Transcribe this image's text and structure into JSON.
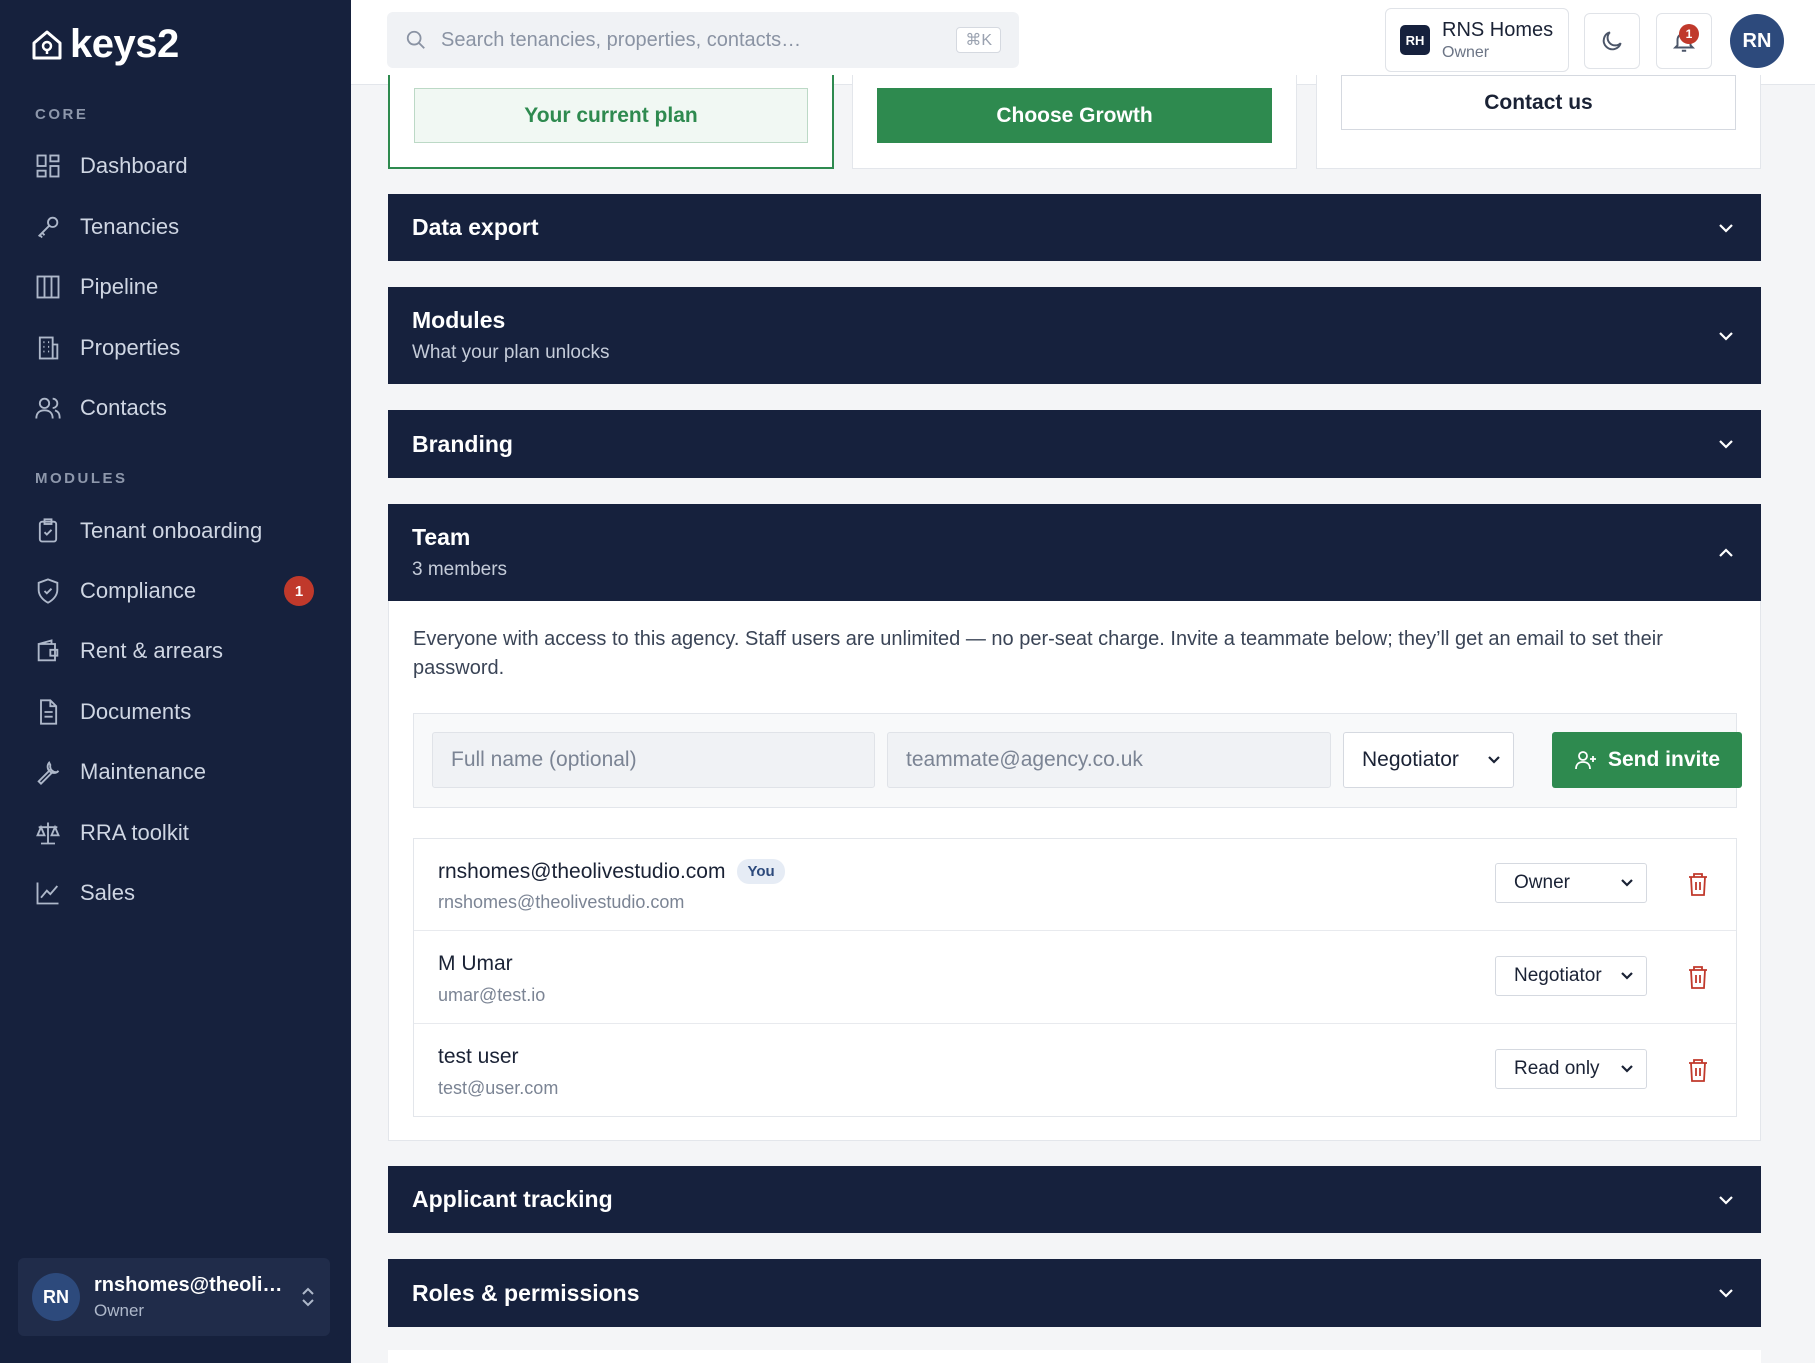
{
  "brand": {
    "name": "keys2"
  },
  "sidebar": {
    "core_label": "CORE",
    "modules_label": "MODULES",
    "core_items": [
      {
        "label": "Dashboard",
        "icon": "dashboard-icon"
      },
      {
        "label": "Tenancies",
        "icon": "key-icon"
      },
      {
        "label": "Pipeline",
        "icon": "columns-icon"
      },
      {
        "label": "Properties",
        "icon": "building-icon"
      },
      {
        "label": "Contacts",
        "icon": "users-icon"
      }
    ],
    "module_items": [
      {
        "label": "Tenant onboarding",
        "icon": "clipboard-icon"
      },
      {
        "label": "Compliance",
        "icon": "shield-icon",
        "badge": "1"
      },
      {
        "label": "Rent & arrears",
        "icon": "wallet-icon"
      },
      {
        "label": "Documents",
        "icon": "document-icon"
      },
      {
        "label": "Maintenance",
        "icon": "wrench-icon"
      },
      {
        "label": "RRA toolkit",
        "icon": "scales-icon"
      },
      {
        "label": "Sales",
        "icon": "chart-icon"
      }
    ],
    "user": {
      "initials": "RN",
      "name": "rnshomes@theolivestudio.com",
      "role": "Owner"
    }
  },
  "topbar": {
    "search_placeholder": "Search tenancies, properties, contacts…",
    "shortcut": "⌘K",
    "org": {
      "badge": "RH",
      "name": "RNS Homes",
      "role": "Owner"
    },
    "notification_count": "1",
    "avatar_initials": "RN"
  },
  "plans": {
    "current_label": "Your current plan",
    "growth_label": "Choose Growth",
    "contact_label": "Contact us"
  },
  "sections": {
    "data_export": "Data export",
    "modules": {
      "title": "Modules",
      "subtitle": "What your plan unlocks"
    },
    "branding": "Branding",
    "team": {
      "title": "Team",
      "subtitle": "3 members"
    },
    "applicant_tracking": "Applicant tracking",
    "roles_permissions": "Roles & permissions"
  },
  "team": {
    "description": "Everyone with access to this agency. Staff users are unlimited — no per-seat charge. Invite a teammate below; they’ll get an email to set their password.",
    "invite": {
      "name_placeholder": "Full name (optional)",
      "email_placeholder": "teammate@agency.co.uk",
      "role_value": "Negotiator",
      "send_label": "Send invite"
    },
    "you_tag": "You",
    "members": [
      {
        "name": "rnshomes@theolivestudio.com",
        "email": "rnshomes@theolivestudio.com",
        "role": "Owner",
        "is_you": true
      },
      {
        "name": "M Umar",
        "email": "umar@test.io",
        "role": "Negotiator"
      },
      {
        "name": "test user",
        "email": "test@user.com",
        "role": "Read only"
      }
    ]
  },
  "colors": {
    "navy": "#16213d",
    "green": "#2e8a4f",
    "danger": "#c0392b"
  }
}
